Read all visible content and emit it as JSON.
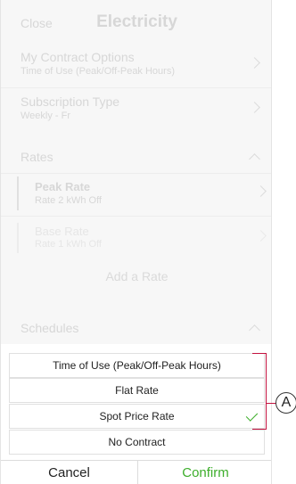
{
  "header": {
    "close_label": "Close",
    "title": "Electricity"
  },
  "contract": {
    "label": "My Contract Options",
    "value": "Time of Use (Peak/Off-Peak Hours)"
  },
  "subscription": {
    "label": "Subscription Type",
    "value": "Weekly - Fr"
  },
  "rates": {
    "section_label": "Rates",
    "items": [
      {
        "name": "Peak Rate",
        "value": "Rate 2 kWh Off"
      },
      {
        "name": "Base Rate",
        "value": "Rate 1 kWh Off"
      }
    ],
    "add_label": "Add a Rate"
  },
  "schedules": {
    "section_label": "Schedules"
  },
  "picker": {
    "options": [
      {
        "label": "Time of Use (Peak/Off-Peak Hours)"
      },
      {
        "label": "Flat Rate"
      },
      {
        "label": "Spot Price Rate",
        "selected": true
      },
      {
        "label": "No Contract"
      }
    ],
    "cancel_label": "Cancel",
    "confirm_label": "Confirm"
  },
  "annotation": {
    "label": "A"
  },
  "colors": {
    "accent": "#3dae2b",
    "callout": "#c3123f"
  }
}
